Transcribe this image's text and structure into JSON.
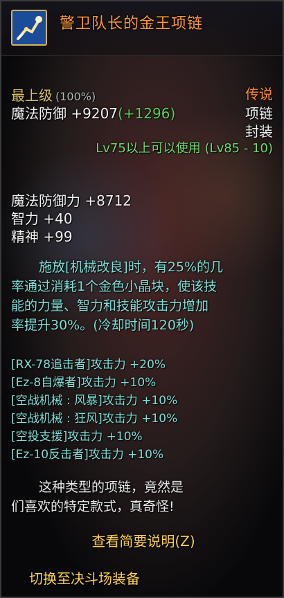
{
  "item": {
    "name": "警卫队长的金王项链",
    "icon": "golden-necklace-icon",
    "grade_label": "最上级",
    "grade_percent": "(100%)",
    "rarity": "传说",
    "magic_defense_label": "魔法防御",
    "magic_defense_value": "+9207",
    "magic_defense_bonus": "(+1296)",
    "slot": "项链",
    "seal": "封装",
    "level_requirement": "Lv75以上可以使用 (Lv85 - 10)"
  },
  "stats": [
    {
      "label": "魔法防御力",
      "value": "+8712"
    },
    {
      "label": "智力",
      "value": "+40"
    },
    {
      "label": "精神",
      "value": "+99"
    }
  ],
  "description": {
    "lines": [
      "施放[机械改良]时，有25%的几",
      "率通过消耗1个金色小晶块，使该技",
      "能的力量、智力和技能攻击力增加",
      "率提升30%。(冷却时间120秒)"
    ]
  },
  "skill_bonuses": [
    "[RX-78追击者]攻击力 +20%",
    "[Ez-8自爆者]攻击力 +10%",
    "[空战机械 : 风暴]攻击力 +10%",
    "[空战机械 : 狂风]攻击力 +10%",
    "[空投支援]攻击力 +10%",
    "[Ez-10反击者]攻击力 +10%"
  ],
  "flavor": {
    "line1": "这种类型的项链，竟然是",
    "line2": "们喜欢的特定款式，真奇怪!"
  },
  "buttons": {
    "summary": "查看简要说明(Z)",
    "switch": "切换至决斗场装备"
  },
  "colors": {
    "name": "#ff9a2e",
    "rarity": "#ff8a1f",
    "bonus": "#58d158",
    "skill_text": "#7fe0d8",
    "button": "#ffd24a"
  }
}
